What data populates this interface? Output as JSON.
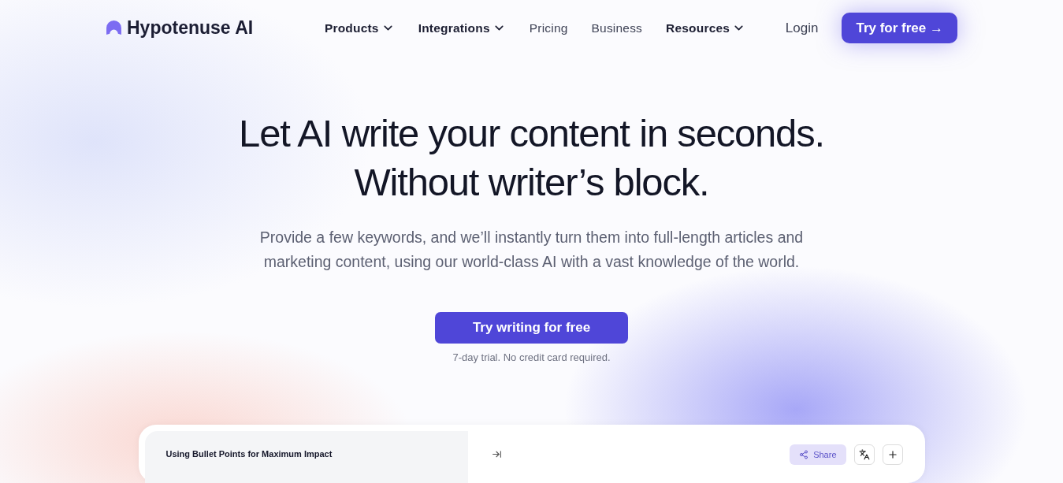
{
  "header": {
    "logo": "Hypotenuse AI",
    "nav": [
      {
        "label": "Products",
        "kind": "dropdown"
      },
      {
        "label": "Integrations",
        "kind": "dropdown"
      },
      {
        "label": "Pricing",
        "kind": "link"
      },
      {
        "label": "Business",
        "kind": "link"
      },
      {
        "label": "Resources",
        "kind": "dropdown"
      }
    ],
    "login": "Login",
    "cta": "Try for free →"
  },
  "hero": {
    "title_lines": [
      "Let AI write your content in seconds.",
      "Without writer’s block."
    ],
    "subtitle": "Provide a few keywords, and we’ll instantly turn them into full-length articles and marketing content, using our world-class AI with a vast knowledge of the world.",
    "cta": "Try writing for free",
    "note": "7-day trial. No credit card required."
  },
  "preview": {
    "document_title": "Using Bullet Points for Maximum Impact",
    "share": "Share"
  }
}
